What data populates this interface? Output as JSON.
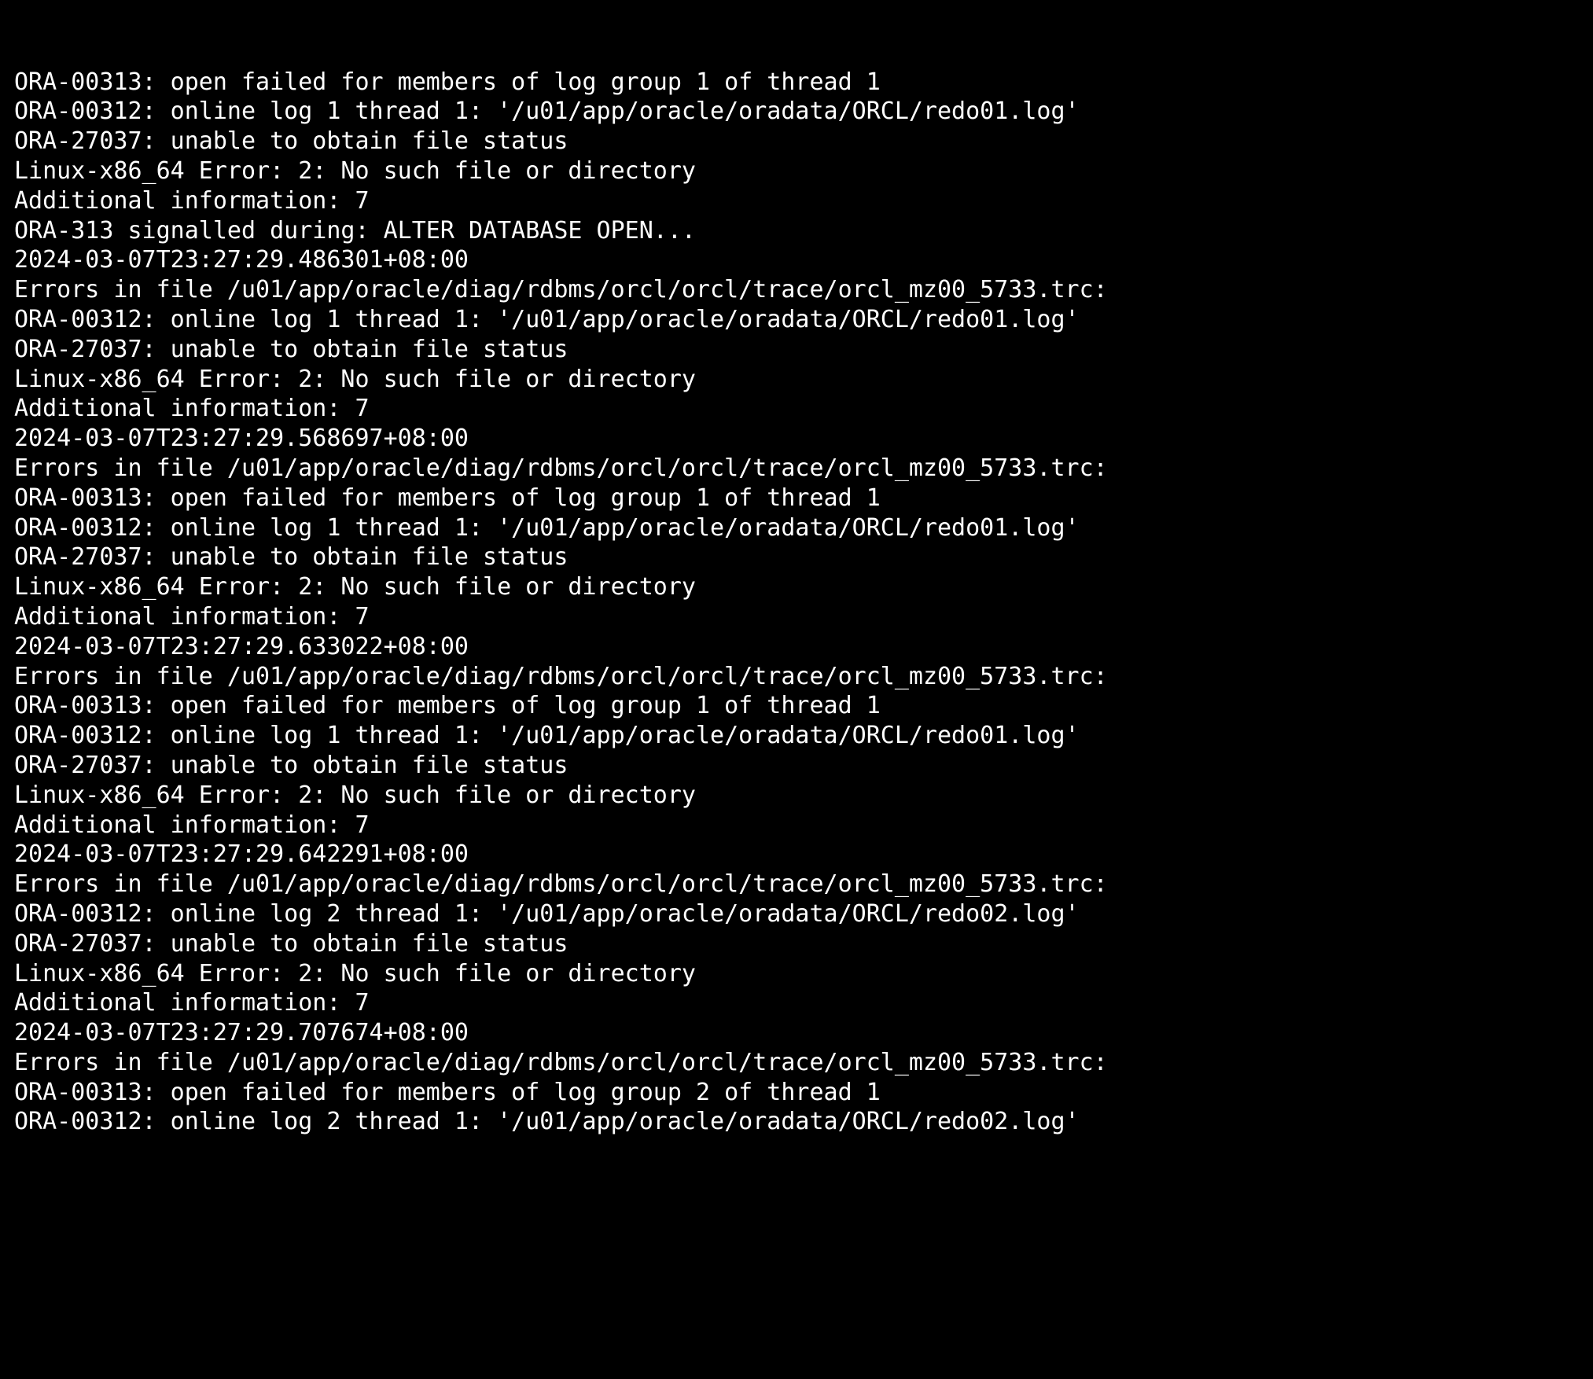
{
  "window": {
    "type": "terminal",
    "background_color": "#000000",
    "foreground_color": "#ffffff",
    "font_kind": "monospace"
  },
  "log": {
    "source": "Oracle database alert log",
    "lines": [
      "ORA-00313: open failed for members of log group 1 of thread 1",
      "ORA-00312: online log 1 thread 1: '/u01/app/oracle/oradata/ORCL/redo01.log'",
      "ORA-27037: unable to obtain file status",
      "Linux-x86_64 Error: 2: No such file or directory",
      "Additional information: 7",
      "ORA-313 signalled during: ALTER DATABASE OPEN...",
      "2024-03-07T23:27:29.486301+08:00",
      "Errors in file /u01/app/oracle/diag/rdbms/orcl/orcl/trace/orcl_mz00_5733.trc:",
      "ORA-00312: online log 1 thread 1: '/u01/app/oracle/oradata/ORCL/redo01.log'",
      "ORA-27037: unable to obtain file status",
      "Linux-x86_64 Error: 2: No such file or directory",
      "Additional information: 7",
      "2024-03-07T23:27:29.568697+08:00",
      "Errors in file /u01/app/oracle/diag/rdbms/orcl/orcl/trace/orcl_mz00_5733.trc:",
      "ORA-00313: open failed for members of log group 1 of thread 1",
      "ORA-00312: online log 1 thread 1: '/u01/app/oracle/oradata/ORCL/redo01.log'",
      "ORA-27037: unable to obtain file status",
      "Linux-x86_64 Error: 2: No such file or directory",
      "Additional information: 7",
      "2024-03-07T23:27:29.633022+08:00",
      "Errors in file /u01/app/oracle/diag/rdbms/orcl/orcl/trace/orcl_mz00_5733.trc:",
      "ORA-00313: open failed for members of log group 1 of thread 1",
      "ORA-00312: online log 1 thread 1: '/u01/app/oracle/oradata/ORCL/redo01.log'",
      "ORA-27037: unable to obtain file status",
      "Linux-x86_64 Error: 2: No such file or directory",
      "Additional information: 7",
      "2024-03-07T23:27:29.642291+08:00",
      "Errors in file /u01/app/oracle/diag/rdbms/orcl/orcl/trace/orcl_mz00_5733.trc:",
      "ORA-00312: online log 2 thread 1: '/u01/app/oracle/oradata/ORCL/redo02.log'",
      "ORA-27037: unable to obtain file status",
      "Linux-x86_64 Error: 2: No such file or directory",
      "Additional information: 7",
      "2024-03-07T23:27:29.707674+08:00",
      "Errors in file /u01/app/oracle/diag/rdbms/orcl/orcl/trace/orcl_mz00_5733.trc:",
      "ORA-00313: open failed for members of log group 2 of thread 1",
      "ORA-00312: online log 2 thread 1: '/u01/app/oracle/oradata/ORCL/redo02.log'"
    ]
  }
}
